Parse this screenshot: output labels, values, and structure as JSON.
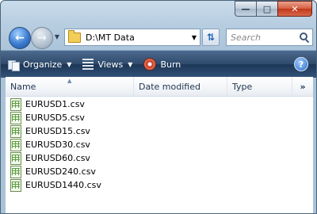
{
  "address": {
    "path": "D:\\MT Data"
  },
  "search": {
    "placeholder": "Search"
  },
  "toolbar": {
    "organize_label": "Organize",
    "views_label": "Views",
    "burn_label": "Burn",
    "help_label": "?"
  },
  "columns": {
    "name": "Name",
    "date_modified": "Date modified",
    "type": "Type",
    "more": "»"
  },
  "files": [
    {
      "name": "EURUSD1.csv",
      "icon": "csv-file-icon"
    },
    {
      "name": "EURUSD5.csv",
      "icon": "csv-file-icon"
    },
    {
      "name": "EURUSD15.csv",
      "icon": "csv-file-icon"
    },
    {
      "name": "EURUSD30.csv",
      "icon": "csv-file-icon"
    },
    {
      "name": "EURUSD60.csv",
      "icon": "csv-file-icon"
    },
    {
      "name": "EURUSD240.csv",
      "icon": "csv-file-icon"
    },
    {
      "name": "EURUSD1440.csv",
      "icon": "csv-file-icon"
    }
  ],
  "colors": {
    "toolbar_bg": "#2e4a6c",
    "frame_bg": "#b7cde0",
    "close_button": "#c2361a"
  }
}
